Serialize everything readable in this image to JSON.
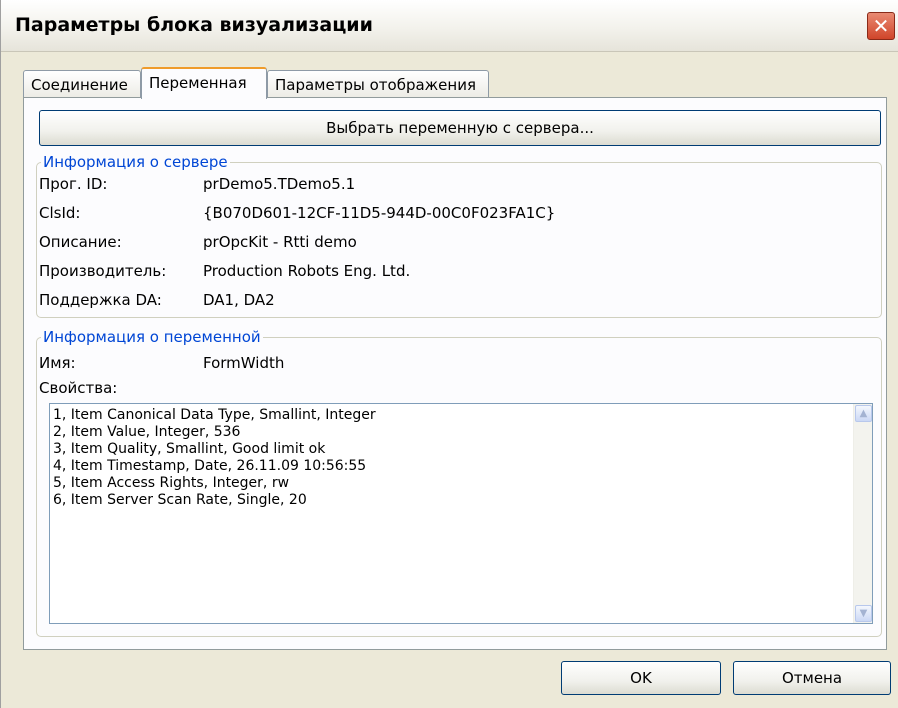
{
  "window": {
    "title": "Параметры блока визуализации",
    "close_glyph": "✕",
    "close_icon": "close-icon"
  },
  "tabs": [
    {
      "label": "Соединение",
      "active": false
    },
    {
      "label": "Переменная",
      "active": true
    },
    {
      "label": "Параметры отображения",
      "active": false
    }
  ],
  "select_button": {
    "label": "Выбрать переменную с сервера..."
  },
  "server_info": {
    "title": "Информация о сервере",
    "rows": [
      {
        "label": "Прог. ID:",
        "value": "prDemo5.TDemo5.1"
      },
      {
        "label": "ClsId:",
        "value": "{B070D601-12CF-11D5-944D-00C0F023FA1C}"
      },
      {
        "label": "Описание:",
        "value": "prOpcKit - Rtti demo"
      },
      {
        "label": "Производитель:",
        "value": "Production Robots Eng. Ltd."
      },
      {
        "label": "Поддержка DA:",
        "value": "DA1, DA2"
      }
    ]
  },
  "variable_info": {
    "title": "Информация о переменной",
    "name_label": "Имя:",
    "name_value": "FormWidth",
    "props_label": "Свойства:",
    "properties": [
      "1, Item Canonical Data Type, Smallint, Integer",
      "2, Item Value, Integer, 536",
      "3, Item Quality, Smallint, Good limit ok",
      "4, Item Timestamp, Date, 26.11.09 10:56:55",
      "5, Item Access Rights, Integer, rw",
      "6, Item Server Scan Rate, Single, 20"
    ],
    "scroll_up_glyph": "▲",
    "scroll_down_glyph": "▼"
  },
  "footer": {
    "ok_label": "OK",
    "cancel_label": "Отмена"
  }
}
